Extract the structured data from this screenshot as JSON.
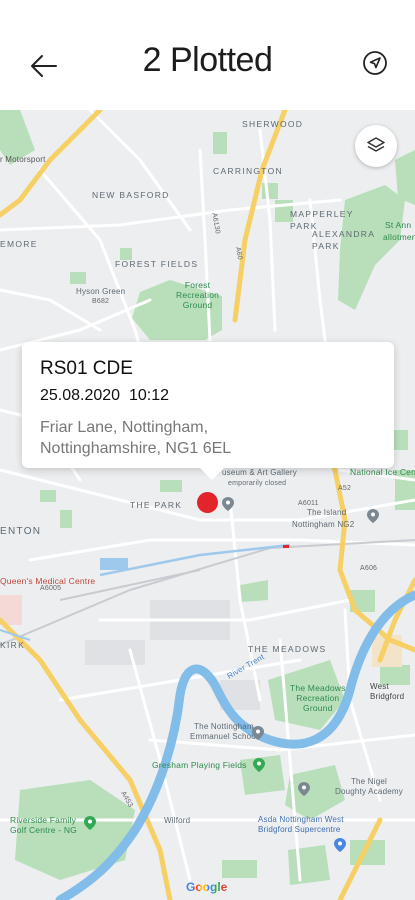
{
  "header": {
    "title": "2 Plotted",
    "back_icon": "arrow-left-icon",
    "locate_icon": "navigation-arrow-icon"
  },
  "map": {
    "layers_icon": "layers-icon",
    "place_labels": {
      "sherwood": "SHERWOOD",
      "motorsport": "r Motorsport",
      "carrington": "CARRINGTON",
      "new_basford": "NEW BASFORD",
      "mapperley_park": "MAPPERLEY\nPARK",
      "alexandra_park": "ALEXANDRA\nPARK",
      "st_ann": "St Ann",
      "allotments": "allotments",
      "emore": "EMORE",
      "forest_fields": "FOREST FIELDS",
      "hyson_green": "Hyson Green",
      "forest_recreation": "Forest\nRecreation\nGround",
      "the_park": "THE PARK",
      "museum": "useum & Art Gallery",
      "temp_closed": "emporarily closed",
      "national_ice": "National Ice Centr",
      "the_island": "The Island",
      "nottingham_ng2": "Nottingham NG2",
      "lenton": "ENTON",
      "queens_medical": "Queen's Medical Centre",
      "kirk": "KIRK",
      "the_meadows": "THE MEADOWS",
      "meadows_rec": "The Meadows\nRecreation\nGround",
      "west_bridgford": "West\nBridgford",
      "emmanuel_school": "The Nottingham\nEmmanuel School",
      "gresham": "Gresham Playing Fields",
      "nigel_doughty": "The Nigel\nDoughty Academy",
      "riverside": "Riverside Family\nGolf Centre - NG",
      "wilford": "Wilford",
      "asda": "Asda Nottingham West\nBridgford Supercentre",
      "river_trent": "River Trent",
      "google": "Google"
    },
    "road_labels": {
      "a60": "A60",
      "a6130": "A6130",
      "a52": "A52",
      "a453": "A453",
      "a6005": "A6005",
      "b682": "B682",
      "a606": "A606",
      "a6011": "A6011"
    }
  },
  "popup": {
    "registration": "RS01 CDE",
    "datetime": "25.08.2020  10:12",
    "address_line1": "Friar Lane, Nottingham,",
    "address_line2": "Nottinghamshire, NG1 6EL"
  },
  "colors": {
    "marker": "#e3242b",
    "map_bg": "#eceef0",
    "water": "#7fb8e6",
    "park": "#b7dfb9",
    "major_road": "#f6cf65"
  }
}
